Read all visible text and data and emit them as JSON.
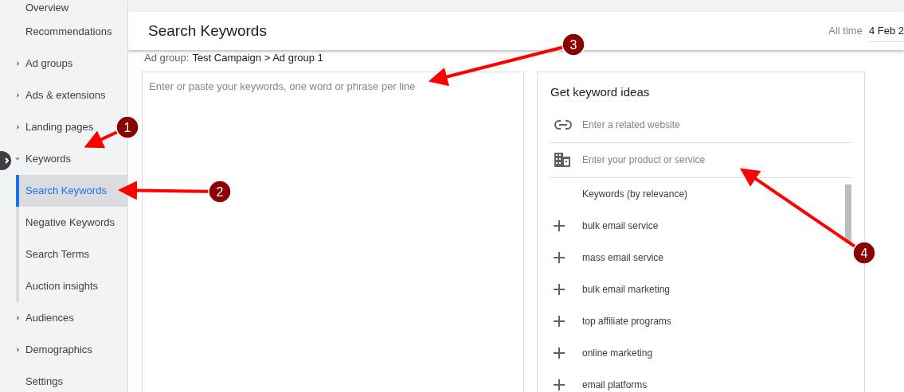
{
  "sidebar": {
    "items": [
      {
        "label": "Overview",
        "kind": "link",
        "selected": false
      },
      {
        "label": "Recommendations",
        "kind": "link",
        "selected": false
      },
      {
        "label": "Ad groups",
        "kind": "group",
        "expanded": false,
        "selected": false
      },
      {
        "label": "Ads & extensions",
        "kind": "group",
        "expanded": false,
        "selected": false
      },
      {
        "label": "Landing pages",
        "kind": "group",
        "expanded": false,
        "selected": false
      },
      {
        "label": "Keywords",
        "kind": "group",
        "expanded": true,
        "selected": false,
        "children": [
          {
            "label": "Search Keywords",
            "selected": true
          },
          {
            "label": "Negative Keywords",
            "selected": false
          },
          {
            "label": "Search Terms",
            "selected": false
          },
          {
            "label": "Auction insights",
            "selected": false
          }
        ]
      },
      {
        "label": "Audiences",
        "kind": "group",
        "expanded": false,
        "selected": false
      },
      {
        "label": "Demographics",
        "kind": "group",
        "expanded": false,
        "selected": false
      },
      {
        "label": "Settings",
        "kind": "link",
        "selected": false
      }
    ]
  },
  "header": {
    "title": "Search Keywords",
    "date_range_label": "All time",
    "date_range": "4 Feb 2"
  },
  "breadcrumb": {
    "prefix": "Ad group:",
    "path": "Test Campaign > Ad group 1"
  },
  "keywords_input": {
    "placeholder": "Enter or paste your keywords, one word or phrase per line"
  },
  "ideas_panel": {
    "title": "Get keyword ideas",
    "fields": [
      {
        "kind": "link",
        "placeholder": "Enter a related website"
      },
      {
        "kind": "building",
        "placeholder": "Enter your product or service"
      }
    ],
    "list_header": "Keywords (by relevance)",
    "keywords": [
      "bulk email service",
      "mass email service",
      "bulk email marketing",
      "top affiliate programs",
      "online marketing",
      "email platforms"
    ]
  },
  "callouts": [
    {
      "label": "1"
    },
    {
      "label": "2"
    },
    {
      "label": "3"
    },
    {
      "label": "4"
    }
  ]
}
